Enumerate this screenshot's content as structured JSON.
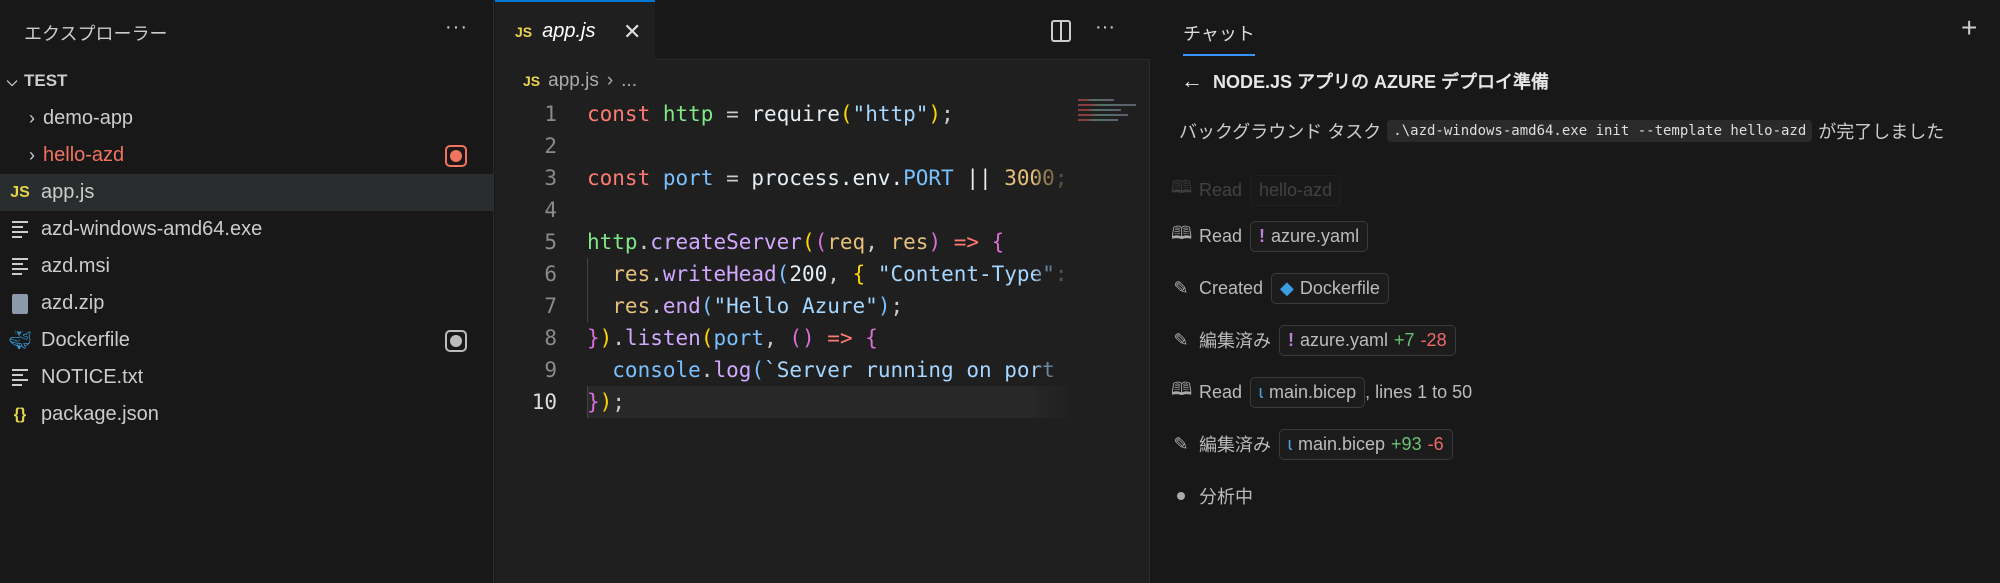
{
  "explorer": {
    "title": "エクスプローラー",
    "more": "···",
    "root": "TEST",
    "items": [
      {
        "label": "demo-app",
        "type": "folder"
      },
      {
        "label": "hello-azd",
        "type": "folder",
        "status": "error"
      },
      {
        "label": "app.js",
        "type": "js",
        "selected": true
      },
      {
        "label": "azd-windows-amd64.exe",
        "type": "text"
      },
      {
        "label": "azd.msi",
        "type": "text"
      },
      {
        "label": "azd.zip",
        "type": "zip"
      },
      {
        "label": "Dockerfile",
        "type": "docker",
        "status": "modified"
      },
      {
        "label": "NOTICE.txt",
        "type": "text"
      },
      {
        "label": "package.json",
        "type": "json"
      }
    ]
  },
  "editor": {
    "tab": {
      "icon": "JS",
      "name": "app.js",
      "close": "✕"
    },
    "more": "···",
    "breadcrumb": {
      "icon": "JS",
      "file": "app.js",
      "sep": "›",
      "rest": "..."
    },
    "current_line": 10,
    "lines": [
      [
        [
          "const ",
          "k"
        ],
        [
          "http",
          "v"
        ],
        [
          " = ",
          "o"
        ],
        [
          "require",
          "w"
        ],
        [
          "(",
          "y"
        ],
        [
          "\"http\"",
          "s"
        ],
        [
          ")",
          "y"
        ],
        [
          ";",
          "o"
        ]
      ],
      [],
      [
        [
          "const ",
          "k"
        ],
        [
          "port",
          "b"
        ],
        [
          " = ",
          "o"
        ],
        [
          "process.env.",
          "w"
        ],
        [
          "PORT",
          "b"
        ],
        [
          " || ",
          "w"
        ],
        [
          "3000;",
          "n"
        ]
      ],
      [],
      [
        [
          "http",
          "v"
        ],
        [
          ".",
          "o"
        ],
        [
          "createServer",
          "f"
        ],
        [
          "(",
          "y"
        ],
        [
          "(",
          "p"
        ],
        [
          "req",
          "n"
        ],
        [
          ", ",
          "o"
        ],
        [
          "res",
          "n"
        ],
        [
          ")",
          "p"
        ],
        [
          " => ",
          "k"
        ],
        [
          "{",
          "p"
        ]
      ],
      [
        [
          "  res",
          "n"
        ],
        [
          ".",
          "o"
        ],
        [
          "writeHead",
          "f"
        ],
        [
          "(",
          "b"
        ],
        [
          "200",
          "w"
        ],
        [
          ", ",
          "o"
        ],
        [
          "{",
          "y"
        ],
        [
          " \"Content-Type\": \"",
          "s"
        ]
      ],
      [
        [
          "  res",
          "n"
        ],
        [
          ".",
          "o"
        ],
        [
          "end",
          "f"
        ],
        [
          "(",
          "b"
        ],
        [
          "\"Hello Azure\"",
          "s"
        ],
        [
          ")",
          "b"
        ],
        [
          ";",
          "o"
        ]
      ],
      [
        [
          "}",
          "p"
        ],
        [
          ")",
          "y"
        ],
        [
          ".",
          "o"
        ],
        [
          "listen",
          "f"
        ],
        [
          "(",
          "y"
        ],
        [
          "port",
          "b"
        ],
        [
          ", ",
          "o"
        ],
        [
          "()",
          "p"
        ],
        [
          " => ",
          "k"
        ],
        [
          "{",
          "p"
        ]
      ],
      [
        [
          "  console",
          "b"
        ],
        [
          ".",
          "o"
        ],
        [
          "log",
          "f"
        ],
        [
          "(",
          "b"
        ],
        [
          "`Server running on port ${",
          "s"
        ]
      ],
      [
        [
          "}",
          "p"
        ],
        [
          ")",
          "y"
        ],
        [
          ";",
          "o"
        ]
      ]
    ]
  },
  "chat": {
    "tab": "チャット",
    "new": "+",
    "title": "NODE.JS アプリの AZURE デプロイ準備",
    "bg_task": {
      "prefix": "バックグラウンド タスク",
      "command": ".\\azd-windows-amd64.exe init --template hello-azd",
      "suffix": "が完了しました"
    },
    "steps": [
      {
        "icon": "read",
        "action": "Read",
        "file": "hello-azd",
        "faded": true
      },
      {
        "icon": "read",
        "action": "Read",
        "file": "azure.yaml",
        "ftype": "yaml"
      },
      {
        "icon": "edit",
        "action": "Created",
        "file": "Dockerfile",
        "ftype": "docker"
      },
      {
        "icon": "edit",
        "action": "編集済み",
        "file": "azure.yaml",
        "ftype": "yaml",
        "added": "+7",
        "removed": "-28"
      },
      {
        "icon": "read",
        "action": "Read",
        "file": "main.bicep",
        "ftype": "bicep",
        "suffix": ", lines 1 to 50"
      },
      {
        "icon": "edit",
        "action": "編集済み",
        "file": "main.bicep",
        "ftype": "bicep",
        "added": "+93",
        "removed": "-6"
      },
      {
        "icon": "dot",
        "action": "分析中"
      }
    ]
  },
  "colors": {
    "accent": "#0078d4",
    "error": "#f0735f",
    "added": "#6cc070",
    "removed": "#f06a6a"
  }
}
